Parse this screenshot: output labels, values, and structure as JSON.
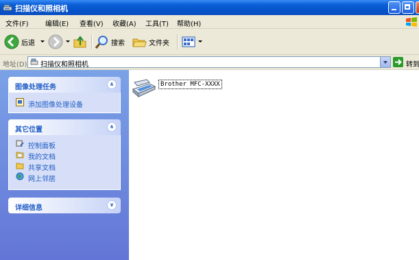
{
  "window": {
    "title": "扫描仪和照相机"
  },
  "menubar": {
    "items": [
      "文件(F)",
      "编辑(E)",
      "查看(V)",
      "收藏(A)",
      "工具(T)",
      "帮助(H)"
    ]
  },
  "toolbar": {
    "back_label": "后退",
    "search_label": "搜索",
    "folders_label": "文件夹"
  },
  "address": {
    "label": "地址(D)",
    "value": "扫描仪和照相机",
    "go_label": "转到"
  },
  "taskpane": {
    "image_tasks": {
      "title": "图像处理任务",
      "items": [
        "添加图像处理设备"
      ]
    },
    "other_places": {
      "title": "其它位置",
      "items": [
        "控制面板",
        "我的文档",
        "共享文档",
        "网上邻居"
      ]
    },
    "details": {
      "title": "详细信息"
    }
  },
  "content": {
    "device_label": "Brother MFC-XXXX"
  },
  "colors": {
    "title_bar": "#0653c9",
    "task_pane": "#7ba2e7",
    "panel_title": "#215dc6"
  },
  "icons": [
    "scanner-camera-icon",
    "back-icon",
    "forward-icon",
    "up-folder-icon",
    "search-icon",
    "folders-icon",
    "views-icon",
    "go-icon",
    "add-device-icon",
    "control-panel-icon",
    "my-documents-icon",
    "shared-documents-icon",
    "network-places-icon",
    "scanner-icon"
  ]
}
